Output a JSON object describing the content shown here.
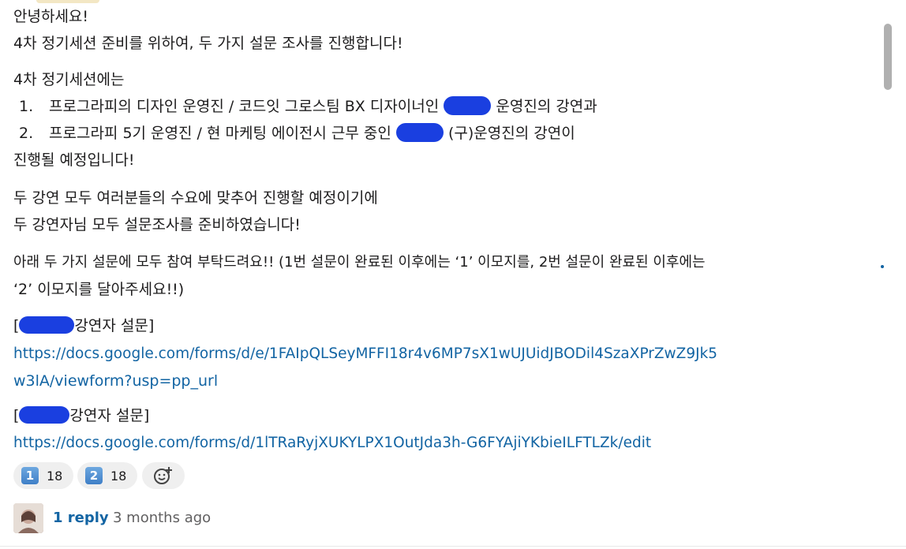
{
  "message": {
    "greeting": "안녕하세요!",
    "intro": "4차 정기세션 준비를 위하여, 두 가지 설문 조사를 진행합니다!",
    "session_intro": "4차 정기세션에는",
    "list": [
      {
        "num": "1.",
        "text_before": "프로그라피의 디자인 운영진 / 코드잇 그로스팀 BX 디자이너인",
        "text_after": "운영진의 강연과"
      },
      {
        "num": "2.",
        "text_before": "프로그라피 5기 운영진 /  현 마케팅 에이전시 근무 중인",
        "text_after": "(구)운영진의 강연이"
      }
    ],
    "closing": "진행될 예정입니다!",
    "para2_line1": "두 강연 모두 여러분들의 수요에 맞추어 진행할 예정이기에",
    "para2_line2": "두 강연자님 모두 설문조사를 준비하였습니다!",
    "para3_line1": "아래 두 가지 설문에 모두 참여 부탁드려요!! (1번 설문이 완료된 이후에는 ‘1’ 이모지를, 2번 설문이 완료된 이후에는",
    "para3_line2": "‘2’ 이모지를 달아주세요!!)",
    "survey1_label": "강연자 설문]",
    "survey1_link_line1": "https://docs.google.com/forms/d/e/1FAIpQLSeyMFFI18r4v6MP7sX1wUJUidJBODil4SzaXPrZwZ9Jk5",
    "survey1_link_line2": "w3lA/viewform?usp=pp_url",
    "survey2_label": "강연자 설문]",
    "survey2_link": "https://docs.google.com/forms/d/1lTRaRyjXUKYLPX1OutJda3h-G6FYAjiYKbieILFTLZk/edit"
  },
  "reactions": [
    {
      "emoji": "1",
      "icon": "keycap-1-icon",
      "count": "18"
    },
    {
      "emoji": "2",
      "icon": "keycap-2-icon",
      "count": "18"
    }
  ],
  "thread": {
    "reply_label": "1 reply",
    "time": "3 months ago"
  },
  "colors": {
    "link": "#1264a3",
    "redaction": "#1a3fe0",
    "reaction_bg": "#efefef"
  }
}
